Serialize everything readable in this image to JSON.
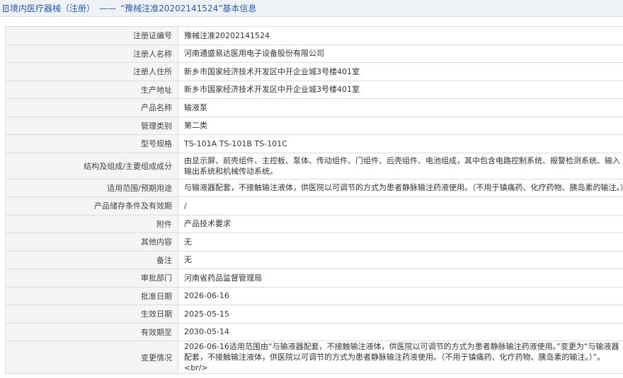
{
  "header": {
    "breadcrumb": "境内医疗器械（注册）",
    "separator": "——",
    "title": "“豫械注准20202141524”基本信息"
  },
  "rows": [
    {
      "label": "注册证编号",
      "value": "豫械注准20202141524"
    },
    {
      "label": "注册人名称",
      "value": "河南通盛易达医用电子设备股份有限公司"
    },
    {
      "label": "注册人住所",
      "value": "新乡市国家经济技术开发区中开企业城3号楼401室"
    },
    {
      "label": "生产地址",
      "value": "新乡市国家经济技术开发区中开企业城3号楼401室"
    },
    {
      "label": "产品名称",
      "value": "输液泵"
    },
    {
      "label": "管理类别",
      "value": "第二类"
    },
    {
      "label": "型号规格",
      "value": "TS-101A TS-101B TS-101C"
    },
    {
      "label": "结构及组成/主要组成成分",
      "value": "由显示屏、前壳组件、主控板、泵体、传动组件、门组件、后壳组件、电池组成，其中包含电路控制系统、报警检测系统、输入输出系统和机械传动系统。"
    },
    {
      "label": "适用范围/预期用途",
      "value": "与输液器配套，不接触输注液体，供医院以可调节的方式为患者静脉输注药液使用。（不用于镇痛药、化疗药物、胰岛素的输注。）"
    },
    {
      "label": "产品储存条件及有效期",
      "value": "/"
    },
    {
      "label": "附件",
      "value": "产品技术要求"
    },
    {
      "label": "其他内容",
      "value": "无"
    },
    {
      "label": "备注",
      "value": "无"
    },
    {
      "label": "审批部门",
      "value": "河南省药品监督管理局"
    },
    {
      "label": "批准日期",
      "value": "2026-06-16"
    },
    {
      "label": "生效日期",
      "value": "2025-05-15"
    },
    {
      "label": "有效期至",
      "value": "2030-05-14"
    },
    {
      "label": "变更情况",
      "value": "2026-06-16适用范围由“与输液器配套，不接触输注液体，供医院以可调节的方式为患者静脉输注药液使用。”变更为“与输液器配套，不接触输注液体，供医院以可调节的方式为患者静脉输注药液使用。（不用于镇痛药、化疗药物、胰岛素的输注。）”。<br/>"
    }
  ]
}
